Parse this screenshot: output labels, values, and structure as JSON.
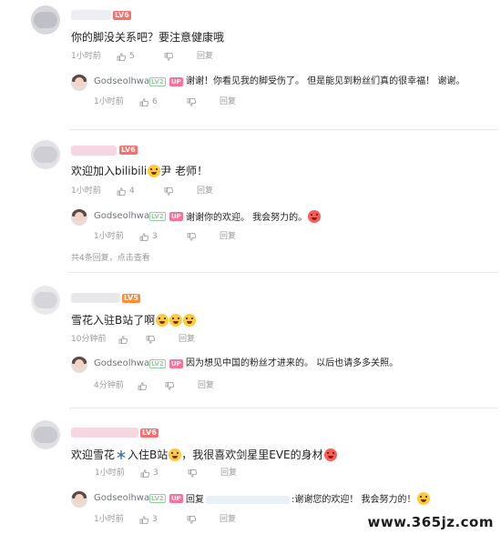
{
  "comments": [
    {
      "level": "LV6",
      "text": "你的脚没关系吧？要注意健康哦",
      "time": "1小时前",
      "likes": "5",
      "reply_label": "回复",
      "reply": {
        "user": "Godseolhwa",
        "lv": "LV2",
        "up": "UP",
        "text": "谢谢！你看见我的脚受伤了。 但是能见到粉丝们真的很幸福！ 谢谢。",
        "time": "1小时前",
        "likes": "6",
        "reply_label": "回复"
      }
    },
    {
      "level": "LV6",
      "text_before": "欢迎加入bilibili",
      "text_after": "尹 老师！",
      "time": "1小时前",
      "likes": "4",
      "reply_label": "回复",
      "reply": {
        "user": "Godseolhwa",
        "lv": "LV2",
        "up": "UP",
        "text": "谢谢你的欢迎。 我会努力的。",
        "time": "1小时前",
        "likes": "3",
        "reply_label": "回复"
      },
      "expand": "共4条回复，点击查看"
    },
    {
      "level": "LV5",
      "text": "雪花入驻B站了啊",
      "time": "10分钟前",
      "likes": "",
      "reply_label": "回复",
      "reply": {
        "user": "Godseolhwa",
        "lv": "LV2",
        "up": "UP",
        "text": "因为想见中国的粉丝才进来的。 以后也请多多关照。",
        "time": "4分钟前",
        "likes": "",
        "reply_label": "回复"
      }
    },
    {
      "level": "LV6",
      "text_before": "欢迎雪花",
      "text_middle": "入住B站",
      "text_after": "，我很喜欢剑星里EVE的身材",
      "time": "1小时前",
      "likes": "3",
      "reply_label": "回复",
      "reply": {
        "user": "Godseolhwa",
        "lv": "LV2",
        "up": "UP",
        "reply_prefix": "回复",
        "text": ":谢谢您的欢迎！ 我会努力的！",
        "time": "1小时前",
        "likes": "3",
        "reply_label": "回复"
      }
    }
  ],
  "watermark": "www.365jz.com",
  "icons": {
    "like": "thumbs-up-icon",
    "dislike": "thumbs-down-icon",
    "emoji": "emoji-icon",
    "snowflake": "snowflake-icon"
  }
}
